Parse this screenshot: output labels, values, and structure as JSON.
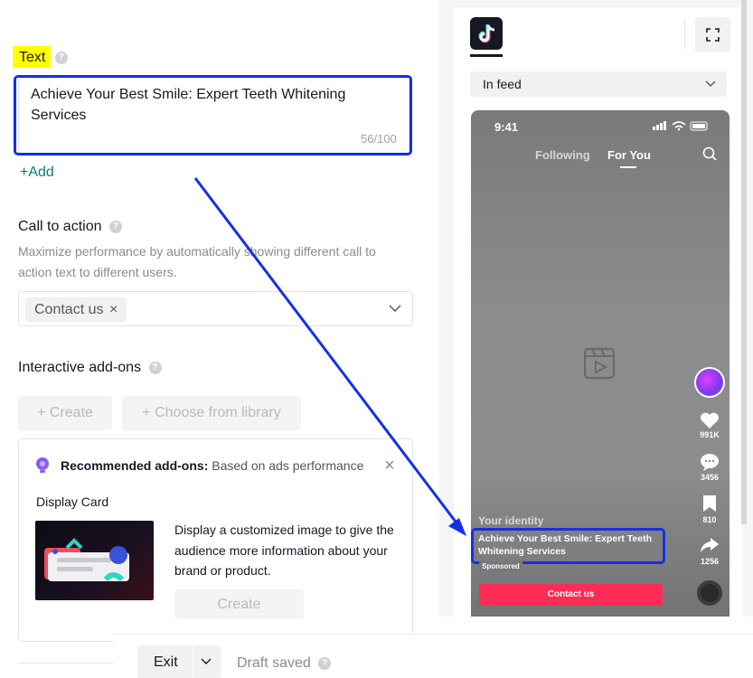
{
  "text_section": {
    "label": "Text",
    "help": "?",
    "value": "Achieve Your Best Smile: Expert Teeth Whitening Services",
    "counter": "56/100",
    "add_label": "+Add"
  },
  "cta_section": {
    "title": "Call to action",
    "help": "?",
    "description_line1": "Maximize performance by automatically showing different call to",
    "description_line2": "action text to different users.",
    "selected_tag": "Contact us",
    "tag_remove": "×"
  },
  "addons_section": {
    "title": "Interactive add-ons",
    "help": "?",
    "create_label": "+ Create",
    "library_label": "+ Choose from library",
    "recommended_label": "Recommended add-ons:",
    "recommended_sub": "Based on ads performance",
    "close": "×",
    "display_card_title": "Display Card",
    "display_card_desc": "Display a customized image to give the audience more information about your brand or product.",
    "display_card_create": "Create"
  },
  "bottom_bar": {
    "exit_label": "Exit",
    "draft_status": "Draft saved",
    "help": "?"
  },
  "preview": {
    "placement": "In feed",
    "status_time": "9:41",
    "tab_following": "Following",
    "tab_for_you": "For You",
    "identity": "Your identity",
    "caption": "Achieve Your Best Smile: Expert Teeth Whitening Services",
    "sponsored": "Sponsored",
    "cta_button": "Contact us",
    "likes": "991K",
    "comments": "3456",
    "saves": "810",
    "shares": "1256"
  },
  "colors": {
    "highlight": "#ffff00",
    "annotation_blue": "#1330e8",
    "teal_link": "#0b7a6f",
    "cta_red": "#fe2c55"
  }
}
